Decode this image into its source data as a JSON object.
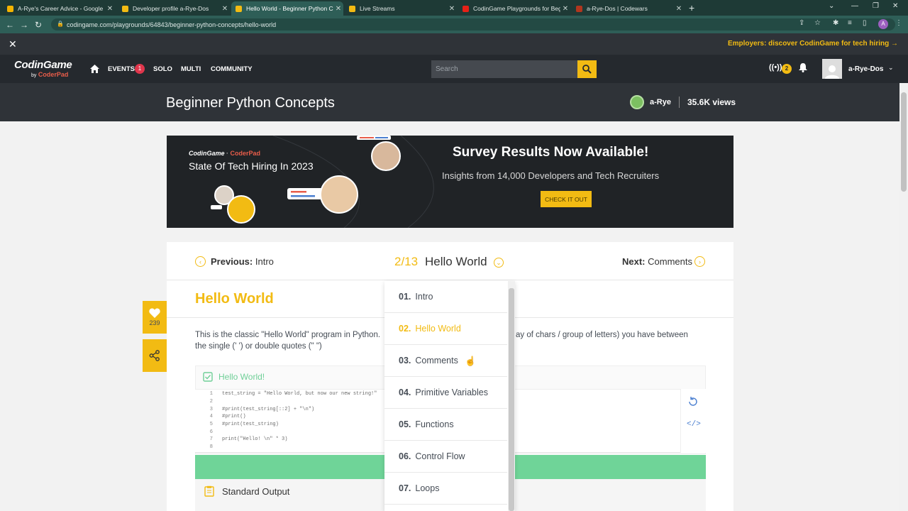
{
  "browser": {
    "tabs": [
      {
        "title": "A-Rye's Career Advice - Google",
        "icon_color": "#f4b400"
      },
      {
        "title": "Developer profile a-Rye-Dos",
        "icon_color": "#f2bb13"
      },
      {
        "title": "Hello World - Beginner Python C",
        "icon_color": "#f2bb13",
        "active": true
      },
      {
        "title": "Live Streams",
        "icon_color": "#f2bb13"
      },
      {
        "title": "CodinGame Playgrounds for Beg",
        "icon_color": "#e62117"
      },
      {
        "title": "a-Rye-Dos | Codewars",
        "icon_color": "#b1361e"
      }
    ],
    "url": "codingame.com/playgrounds/64843/beginner-python-concepts/hello-world",
    "profile_initial": "A"
  },
  "promo": {
    "text": "Employers: discover CodinGame for tech hiring"
  },
  "nav": {
    "logo": "CodinGame",
    "logo_by": "by",
    "logo_sub": "CoderPad",
    "links": [
      "EVENTS",
      "SOLO",
      "MULTI",
      "COMMUNITY"
    ],
    "events_badge": "1",
    "search_placeholder": "Search",
    "live_badge": "2",
    "username": "a-Rye-Dos"
  },
  "header": {
    "title": "Beginner Python Concepts",
    "author": "a-Rye",
    "views": "35.6K views"
  },
  "banner": {
    "brand": "CodinGame",
    "brand_x": "· ",
    "brand_coderpad": "CoderPad",
    "title": "State Of Tech Hiring In 2023",
    "headline": "Survey Results Now Available!",
    "subtitle": "Insights from 14,000 Developers and Tech Recruiters",
    "cta": "CHECK IT OUT"
  },
  "pager": {
    "prev_prefix": "Previous:",
    "prev": "Intro",
    "count": "2/13",
    "current": "Hello World",
    "next_prefix": "Next:",
    "next": "Comments"
  },
  "lesson": {
    "title": "Hello World",
    "para_left": "This is the classic \"Hello World\" program in Python.",
    "para_right": "ay of chars / group of letters) you have between",
    "para_line2": "the single (' ') or double quotes (\" \")",
    "likes": "239"
  },
  "code": {
    "header": "Hello World!",
    "lines": [
      {
        "n": "1",
        "t": "test_string = \"Hello World, but now our new string!\""
      },
      {
        "n": "2",
        "t": ""
      },
      {
        "n": "3",
        "t": "#print(test_string[::2] + \"\\n\")"
      },
      {
        "n": "4",
        "t": "#print()"
      },
      {
        "n": "5",
        "t": "#print(test_string)"
      },
      {
        "n": "6",
        "t": ""
      },
      {
        "n": "7",
        "t": "print(\"Hello! \\n\" * 3)"
      },
      {
        "n": "8",
        "t": ""
      }
    ],
    "output_label": "Standard Output"
  },
  "dropdown": [
    {
      "num": "01.",
      "label": "Intro"
    },
    {
      "num": "02.",
      "label": "Hello World",
      "current": true
    },
    {
      "num": "03.",
      "label": "Comments"
    },
    {
      "num": "04.",
      "label": "Primitive Variables"
    },
    {
      "num": "05.",
      "label": "Functions"
    },
    {
      "num": "06.",
      "label": "Control Flow"
    },
    {
      "num": "07.",
      "label": "Loops"
    }
  ]
}
